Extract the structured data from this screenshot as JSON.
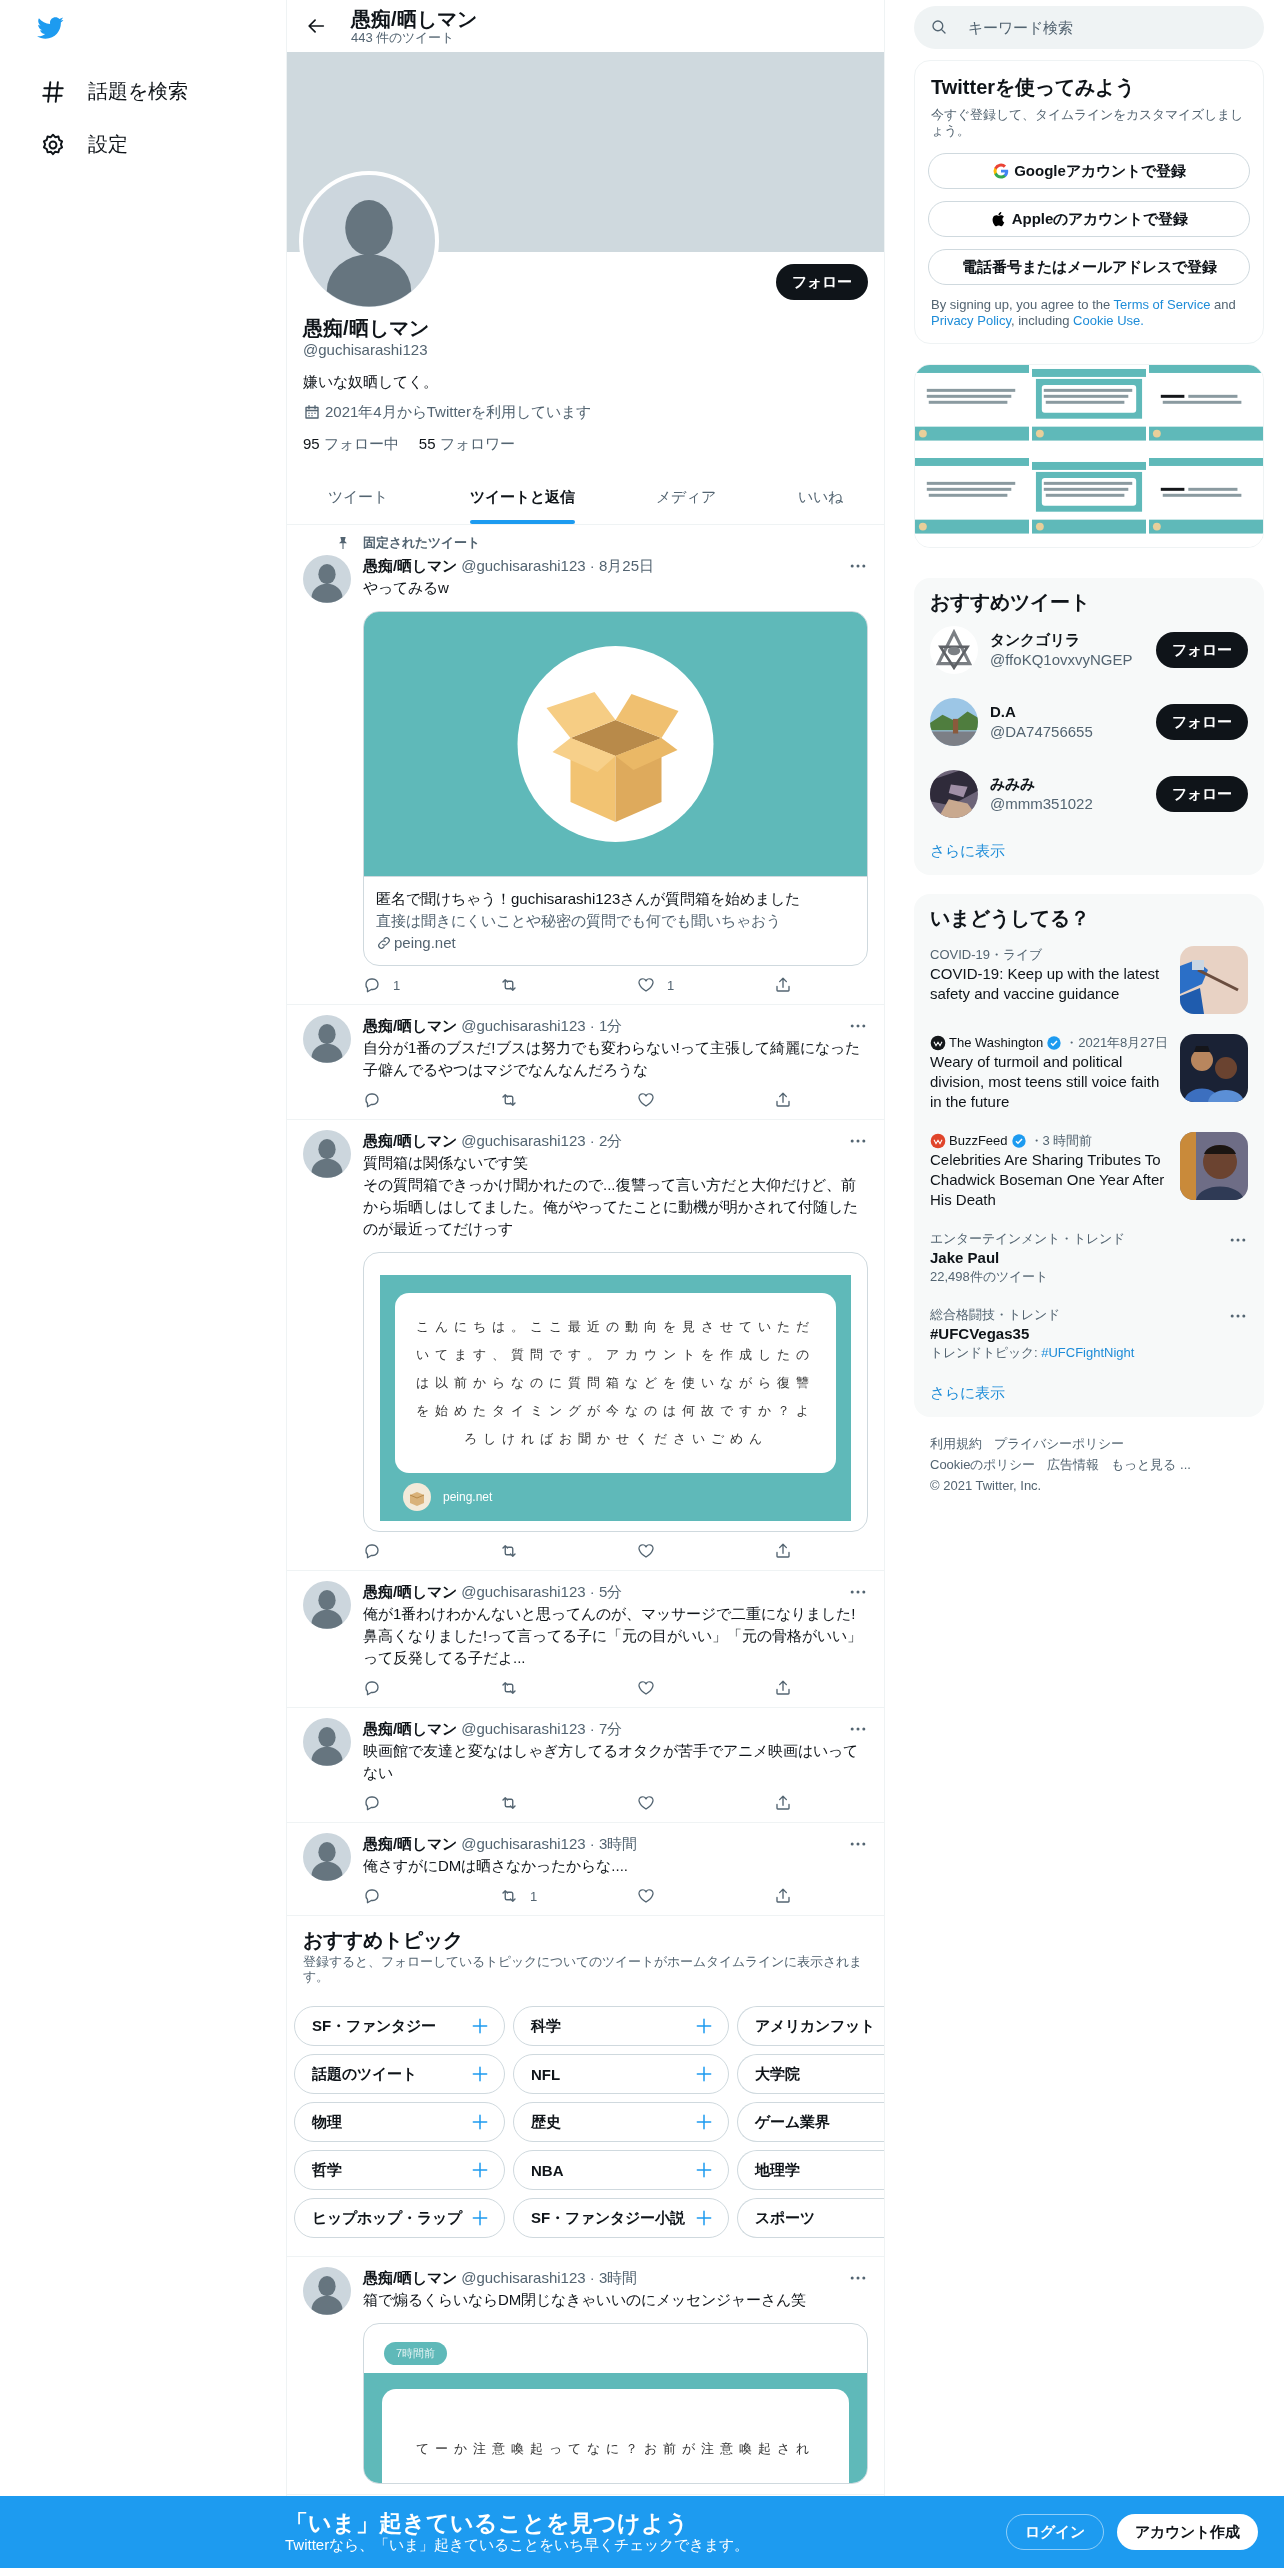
{
  "sidebar": {
    "items": [
      {
        "kind": "explore",
        "label": "話題を検索"
      },
      {
        "kind": "settings",
        "label": "設定"
      }
    ]
  },
  "header": {
    "title": "愚痴/晒しマン",
    "subtitle": "443 件のツイート"
  },
  "profile": {
    "follow_button": "フォロー",
    "name": "愚痴/晒しマン",
    "handle": "@guchisarashi123",
    "bio": "嫌いな奴晒してく。",
    "joined": "2021年4月からTwitterを利用しています",
    "following_count": "95",
    "following_label": "フォロー中",
    "followers_count": "55",
    "followers_label": "フォロワー"
  },
  "tabs": [
    {
      "label": "ツイート",
      "selected": false
    },
    {
      "label": "ツイートと返信",
      "selected": true
    },
    {
      "label": "メディア",
      "selected": false
    },
    {
      "label": "いいね",
      "selected": false
    }
  ],
  "timeline": [
    {
      "kind": "tweet",
      "pinned_label": "固定されたツイート",
      "name": "愚痴/晒しマン",
      "handle_time": "@guchisarashi123 · 8月25日",
      "text": [
        "やってみるw"
      ],
      "card": {
        "kind": "link",
        "title": "匿名で聞けちゃう！guchisarashi123さんが質問箱を始めました",
        "description": "直接は聞きにくいことや秘密の質問でも何でも聞いちゃおう",
        "domain": "peing.net"
      },
      "actions": [
        {
          "kind": "reply",
          "count": "1"
        },
        {
          "kind": "retweet"
        },
        {
          "kind": "like",
          "count": "1"
        },
        {
          "kind": "share"
        }
      ]
    },
    {
      "kind": "tweet",
      "name": "愚痴/晒しマン",
      "handle_time": "@guchisarashi123 · 1分",
      "text": [
        "自分が1番のブスだ!ブスは努力でも変わらない!って主張して綺麗になった子僻んでるやつはマジでなんなんだろうな"
      ],
      "actions": [
        {
          "kind": "reply"
        },
        {
          "kind": "retweet"
        },
        {
          "kind": "like"
        },
        {
          "kind": "share"
        }
      ]
    },
    {
      "kind": "tweet",
      "name": "愚痴/晒しマン",
      "handle_time": "@guchisarashi123 · 2分",
      "text": [
        "質問箱は関係ないです笑",
        "その質問箱できっかけ聞かれたので...復讐って言い方だと大仰だけど、前から垢晒しはしてました。俺がやってたことに動機が明かされて付随したのが最近ってだけっす"
      ],
      "card": {
        "kind": "question",
        "question": "こんにちは。ここ最近の動向を見させていただいてます、質問です。アカウントを作成したのは以前からなのに質問箱などを使いながら復讐を始めたタイミングが今なのは何故ですか？よろしければお聞かせくださいごめん",
        "domain": "peing.net"
      },
      "actions": [
        {
          "kind": "reply"
        },
        {
          "kind": "retweet"
        },
        {
          "kind": "like"
        },
        {
          "kind": "share"
        }
      ]
    },
    {
      "kind": "tweet",
      "name": "愚痴/晒しマン",
      "handle_time": "@guchisarashi123 · 5分",
      "text": [
        "俺が1番わけわかんないと思ってんのが、マッサージで二重になりました!鼻高くなりました!って言ってる子に「元の目がいい」「元の骨格がいい」って反発してる子だよ..."
      ],
      "actions": [
        {
          "kind": "reply"
        },
        {
          "kind": "retweet"
        },
        {
          "kind": "like"
        },
        {
          "kind": "share"
        }
      ]
    },
    {
      "kind": "tweet",
      "name": "愚痴/晒しマン",
      "handle_time": "@guchisarashi123 · 7分",
      "text": [
        "映画館で友達と変なはしゃぎ方してるオタクが苦手でアニメ映画はいってない"
      ],
      "actions": [
        {
          "kind": "reply"
        },
        {
          "kind": "retweet"
        },
        {
          "kind": "like"
        },
        {
          "kind": "share"
        }
      ]
    },
    {
      "kind": "tweet",
      "name": "愚痴/晒しマン",
      "handle_time": "@guchisarashi123 · 3時間",
      "text": [
        "俺さすがにDMは晒さなかったからな...."
      ],
      "actions": [
        {
          "kind": "reply"
        },
        {
          "kind": "retweet",
          "count": "1"
        },
        {
          "kind": "like"
        },
        {
          "kind": "share"
        }
      ]
    },
    {
      "kind": "topics",
      "title": "おすすめトピック",
      "subtitle": "登録すると、フォローしているトピックについてのツイートがホームタイムラインに表示されます。",
      "items": [
        "SF・ファンタジー",
        "科学",
        "アメリカンフット",
        "話題のツイート",
        "NFL",
        "大学院",
        "物理",
        "歴史",
        "ゲーム業界",
        "哲学",
        "NBA",
        "地理学",
        "ヒップホップ・ラップ",
        "SF・ファンタジー小説",
        "スポーツ"
      ]
    },
    {
      "kind": "tweet",
      "name": "愚痴/晒しマン",
      "handle_time": "@guchisarashi123 · 3時間",
      "text": [
        "箱で煽るくらいならDM閉じなきゃいいのにメッセンジャーさん笑"
      ],
      "card": {
        "kind": "question_badge",
        "badge": "7時間前",
        "question": "てーか注意喚起ってなに？お前が注意喚起され"
      }
    }
  ],
  "search": {
    "placeholder": "キーワード検索"
  },
  "signup": {
    "title": "Twitterを使ってみよう",
    "subtitle": "今すぐ登録して、タイムラインをカスタマイズしましょう。",
    "buttons": [
      {
        "kind": "google",
        "label": "Googleアカウントで登録"
      },
      {
        "kind": "apple",
        "label": "Appleのアカウントで登録"
      },
      {
        "kind": "phone",
        "label": "電話番号またはメールアドレスで登録"
      }
    ],
    "terms": [
      {
        "text": "By signing up, you agree to the ",
        "link": false
      },
      {
        "text": "Terms of Service",
        "link": true
      },
      {
        "text": " and ",
        "link": false
      },
      {
        "text": "Privacy Policy",
        "link": true
      },
      {
        "text": ", including ",
        "link": false
      },
      {
        "text": "Cookie Use.",
        "link": true
      }
    ]
  },
  "recommended": {
    "title": "おすすめツイート",
    "users": [
      {
        "name": "タンクゴリラ",
        "handle": "@ffoKQ1ovxvyNGEP",
        "button": "フォロー"
      },
      {
        "name": "D.A",
        "handle": "@DA74756655",
        "button": "フォロー"
      },
      {
        "name": "みみみ",
        "handle": "@mmm351022",
        "button": "フォロー"
      }
    ],
    "show_more": "さらに表示"
  },
  "trends": {
    "title": "いまどうしてる？",
    "items": [
      {
        "kind": "news",
        "meta": "COVID-19・ライブ",
        "headline": "COVID-19: Keep up with the latest safety and vaccine guidance"
      },
      {
        "kind": "news",
        "source": "The Washington",
        "color": "#14171a",
        "verified": true,
        "meta": "・2021年8月27日",
        "headline": "Weary of turmoil and political division, most teens still voice faith in the future"
      },
      {
        "kind": "news",
        "source": "BuzzFeed",
        "color": "#e0452b",
        "verified": true,
        "meta": "・3 時間前",
        "headline": "Celebrities Are Sharing Tributes To Chadwick Boseman One Year After His Death"
      },
      {
        "kind": "trend",
        "meta": "エンターテインメント・トレンド",
        "title": "Jake Paul",
        "sub": "22,498件のツイート"
      },
      {
        "kind": "trend",
        "meta": "総合格闘技・トレンド",
        "title": "#UFCVegas35",
        "sub": "トレンドトピック: ",
        "sub_link": "#UFCFightNight"
      }
    ],
    "show_more": "さらに表示"
  },
  "footer": {
    "links": [
      "利用規約",
      "プライバシーポリシー",
      "Cookieのポリシー",
      "広告情報",
      "もっと見る ..."
    ],
    "copyright": "© 2021 Twitter, Inc."
  },
  "cta": {
    "title": "「いま」起きていることを見つけよう",
    "subtitle": "Twitterなら、「いま」起きていることをいち早くチェックできます。",
    "login": "ログイン",
    "signup": "アカウント作成"
  }
}
